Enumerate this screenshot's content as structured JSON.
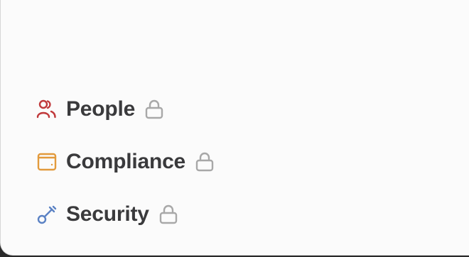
{
  "sidebar": {
    "items": [
      {
        "label": "People",
        "icon": "people-icon",
        "icon_color": "#c0393b",
        "locked": true
      },
      {
        "label": "Compliance",
        "icon": "wallet-icon",
        "icon_color": "#e29a3c",
        "locked": true
      },
      {
        "label": "Security",
        "icon": "key-icon",
        "icon_color": "#5b82c4",
        "locked": true
      }
    ]
  },
  "colors": {
    "label": "#3a3a3c",
    "lock": "#a8a8a8",
    "background": "#fbfbfb"
  }
}
